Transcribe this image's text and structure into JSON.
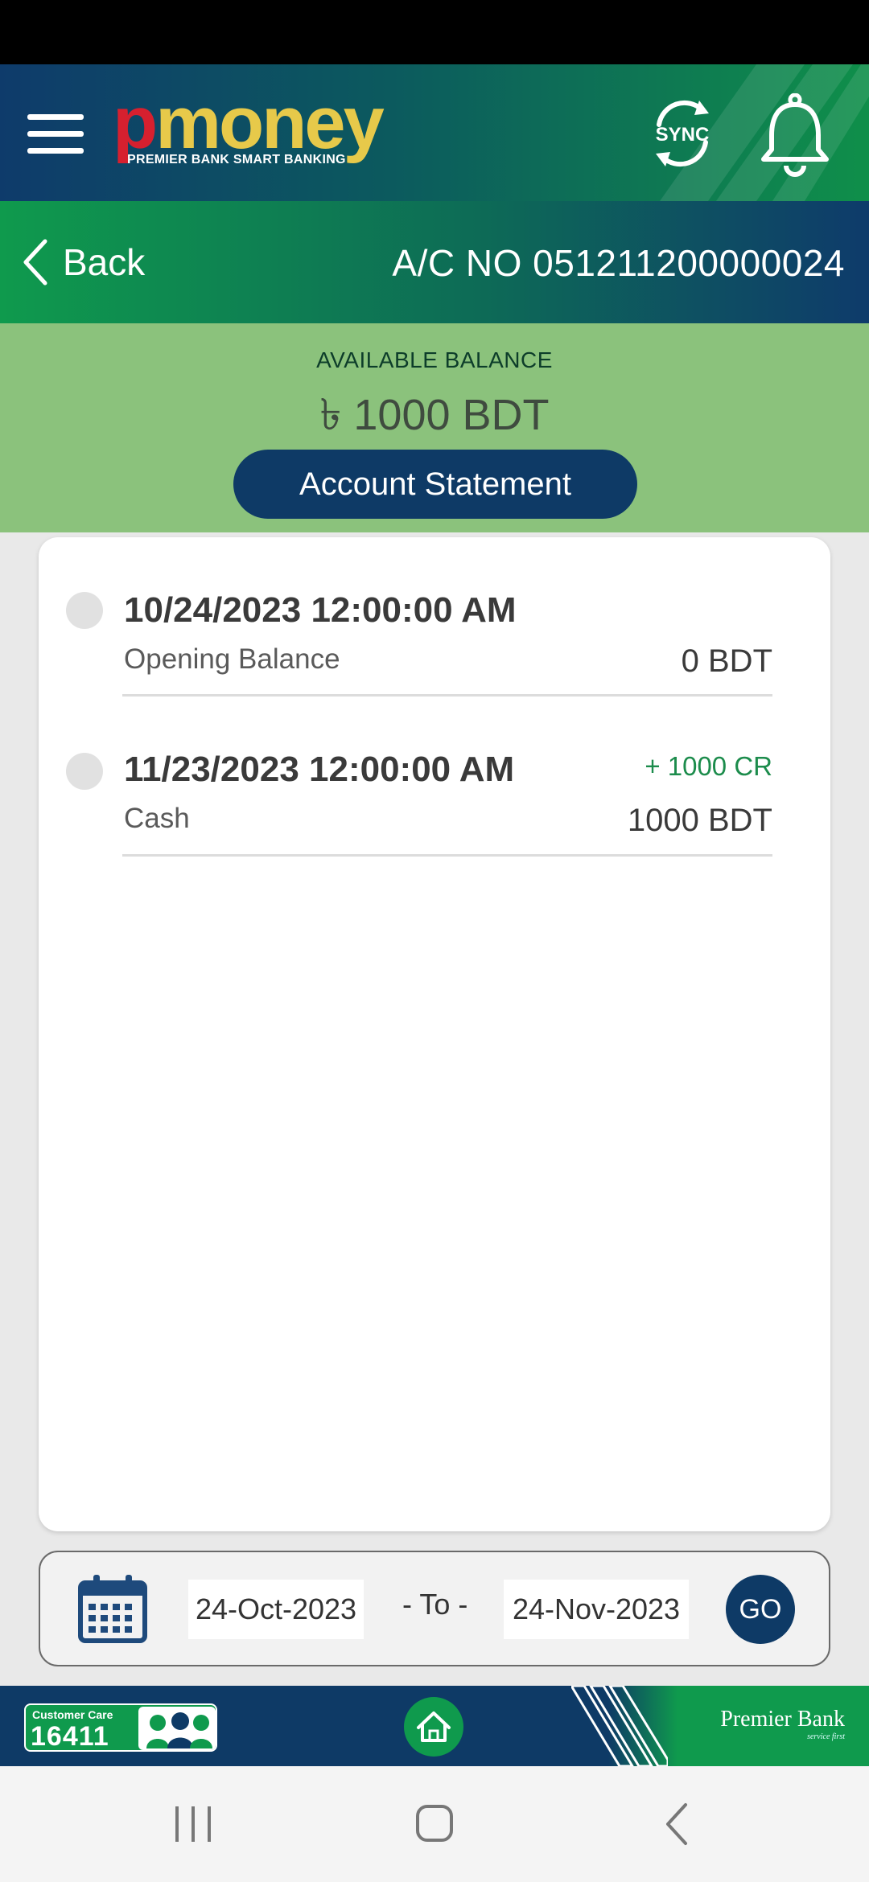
{
  "header": {
    "logo_p": "p",
    "logo_rest": "money",
    "logo_tagline": "PREMIER BANK SMART BANKING",
    "sync_label": "SYNC"
  },
  "subheader": {
    "back_label": "Back",
    "account_number": "A/C NO 051211200000024"
  },
  "balance": {
    "label": "AVAILABLE BALANCE",
    "value": "৳ 1000 BDT"
  },
  "statement_button": "Account Statement",
  "transactions": [
    {
      "date": "10/24/2023 12:00:00 AM",
      "description": "Opening Balance",
      "credit": "",
      "amount": "0 BDT"
    },
    {
      "date": "11/23/2023 12:00:00 AM",
      "description": "Cash",
      "credit": "+ 1000 CR",
      "amount": "1000 BDT"
    }
  ],
  "filter": {
    "from_date": "24-Oct-2023",
    "separator": "- To -",
    "to_date": "24-Nov-2023",
    "go_label": "GO"
  },
  "footer": {
    "care_label": "Customer Care",
    "care_number": "16411",
    "bank_name": "Premier Bank",
    "bank_tagline": "service first"
  },
  "colors": {
    "navy": "#0e3a66",
    "green": "#0f9a4d",
    "balance_arc": "#8bc27c",
    "credit_green": "#1c8c4c",
    "logo_red": "#d6202f",
    "logo_gold": "#e7c94a"
  },
  "icons": {
    "menu": "menu-icon",
    "sync": "sync-icon",
    "bell": "bell-icon",
    "back": "chevron-left-icon",
    "calendar": "calendar-icon",
    "home": "home-icon",
    "nav_recent": "recent-apps-icon",
    "nav_home": "home-square-icon",
    "nav_back": "back-chevron-icon"
  }
}
